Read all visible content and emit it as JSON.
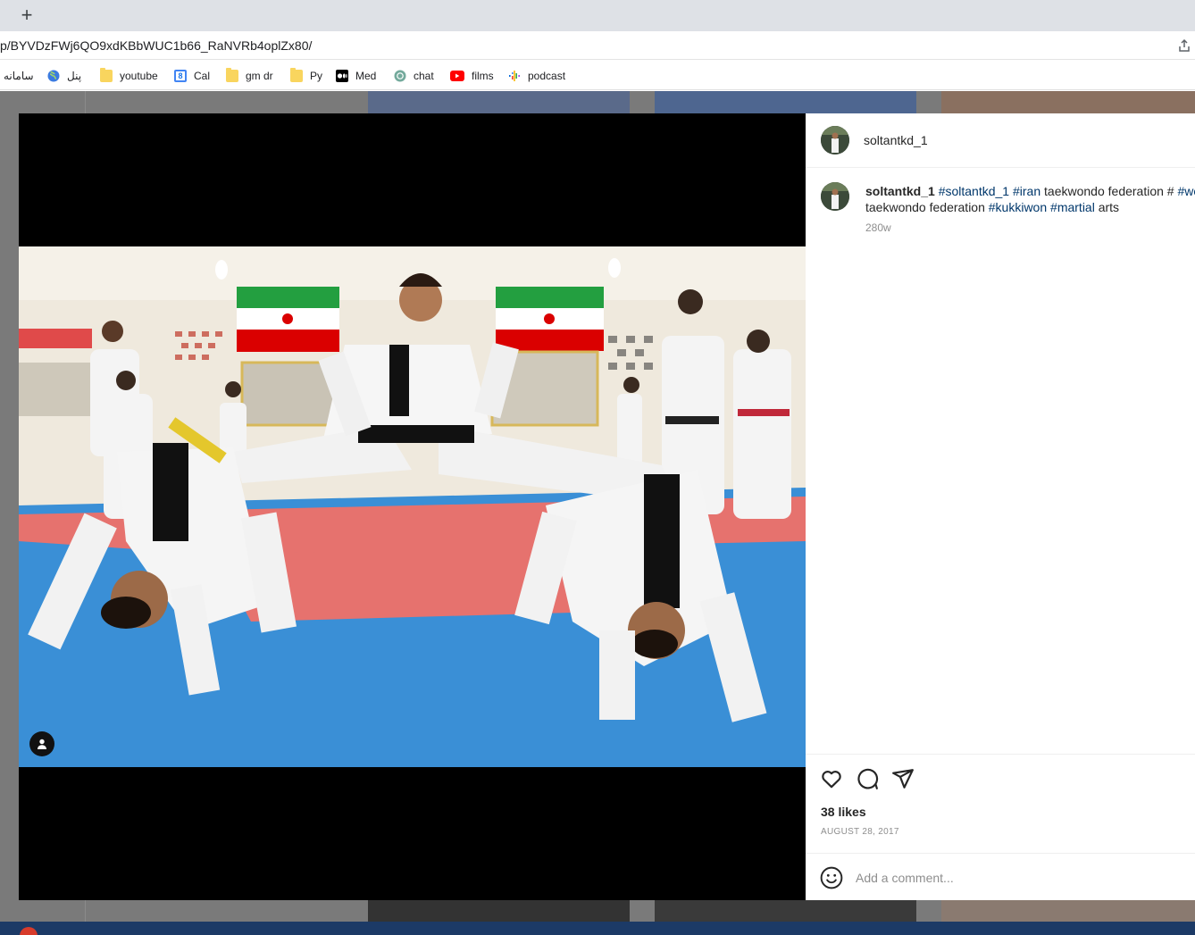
{
  "browser": {
    "new_tab_label": "+",
    "url": "p/BYVDzFWj6QO9xdKBbWUC1b66_RaNVRb4oplZx80/",
    "bookmarks": [
      {
        "label": "سامانه",
        "icon": "none"
      },
      {
        "label": "پنل",
        "icon": "globe-icon"
      },
      {
        "label": "youtube",
        "icon": "folder-icon"
      },
      {
        "label": "Cal",
        "icon": "calendar-icon"
      },
      {
        "label": "gm dr",
        "icon": "folder-icon"
      },
      {
        "label": "Py",
        "icon": "folder-icon"
      },
      {
        "label": "Med",
        "icon": "medium-icon"
      },
      {
        "label": "chat",
        "icon": "chatgpt-icon"
      },
      {
        "label": "films",
        "icon": "youtube-icon"
      },
      {
        "label": "podcast",
        "icon": "podcasts-icon"
      }
    ],
    "calendar_icon_text": "8"
  },
  "post": {
    "username": "soltantkd_1",
    "caption": {
      "username": "soltantkd_1",
      "line1": [
        {
          "text": "#soltantkd_1",
          "tag": true
        },
        {
          "text": "#iran",
          "tag": true
        },
        {
          "text": "taekwondo federation #",
          "tag": false
        },
        {
          "text": "#wo",
          "tag": true
        }
      ],
      "line2": [
        {
          "text": "taekwondo federation",
          "tag": false
        },
        {
          "text": "#kukkiwon",
          "tag": true
        },
        {
          "text": "#martial",
          "tag": true
        },
        {
          "text": "arts",
          "tag": false
        }
      ]
    },
    "caption_age": "280w",
    "likes": "38 likes",
    "date": "AUGUST 28, 2017",
    "comment_placeholder": "Add a comment...",
    "icons": [
      "heart-icon",
      "comment-icon",
      "share-icon",
      "emoji-icon",
      "user-tag-icon"
    ]
  },
  "colors": {
    "hashtag": "#00376b",
    "muted": "#8e8e8e",
    "text": "#262626",
    "mat_blue": "#3a8fd6",
    "mat_red": "#e6726e"
  }
}
